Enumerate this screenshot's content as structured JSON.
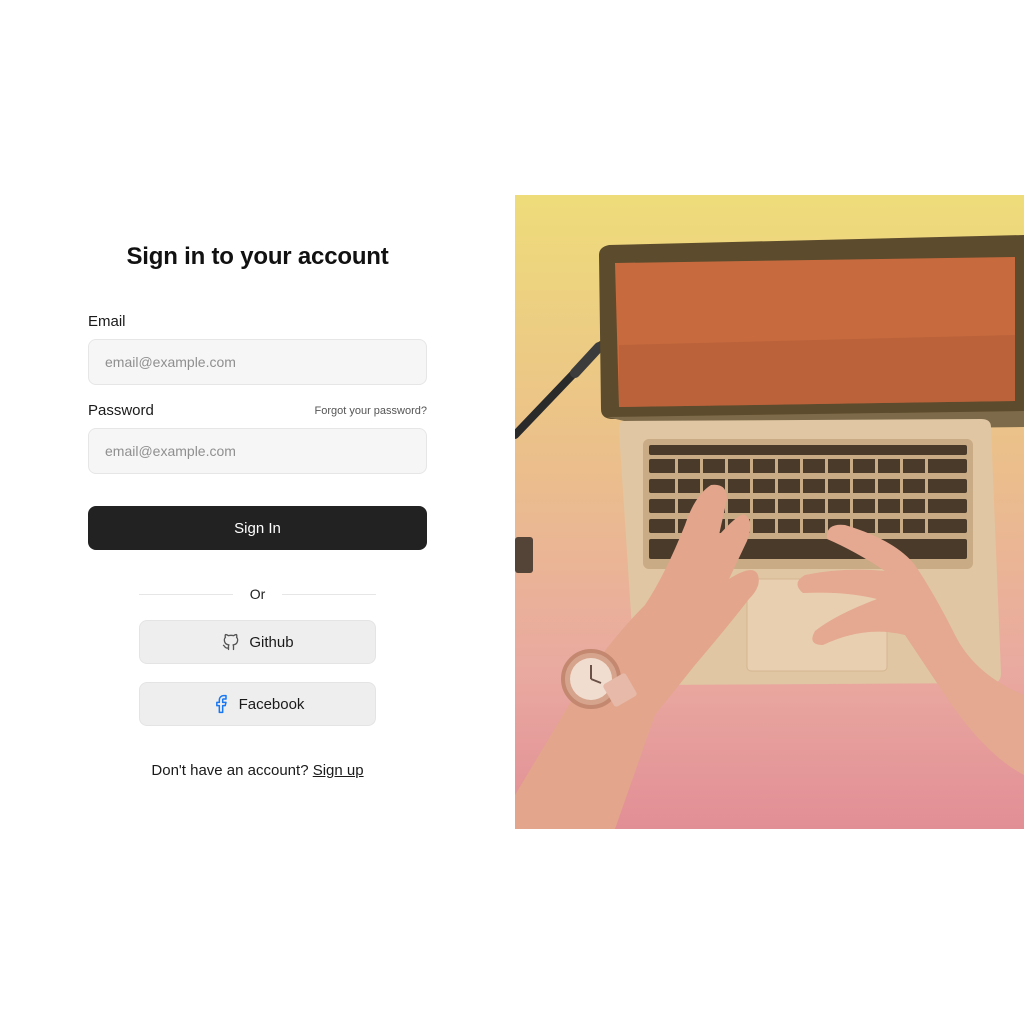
{
  "form": {
    "title": "Sign in to your account",
    "email": {
      "label": "Email",
      "placeholder": "email@example.com",
      "value": ""
    },
    "password": {
      "label": "Password",
      "placeholder": "email@example.com",
      "value": "",
      "forgot_label": "Forgot your password?"
    },
    "submit_label": "Sign In",
    "divider_text": "Or",
    "social": {
      "github_label": "Github",
      "github_icon": "github-icon",
      "facebook_label": "Facebook",
      "facebook_icon": "facebook-icon",
      "facebook_color": "#1877f2"
    },
    "signup_prompt": "Don't have an account?",
    "signup_label": "Sign up"
  },
  "hero_image": {
    "subject": "hands typing on a laptop keyboard, wearing a wristwatch, with a pen on a desk",
    "gradient_colors": [
      "#eedc7a",
      "#ebc08a",
      "#e9a9a0",
      "#e28e95"
    ]
  },
  "colors": {
    "primary_button": "#222222",
    "input_background": "#f6f6f6",
    "social_button_background": "#eeeeee"
  }
}
